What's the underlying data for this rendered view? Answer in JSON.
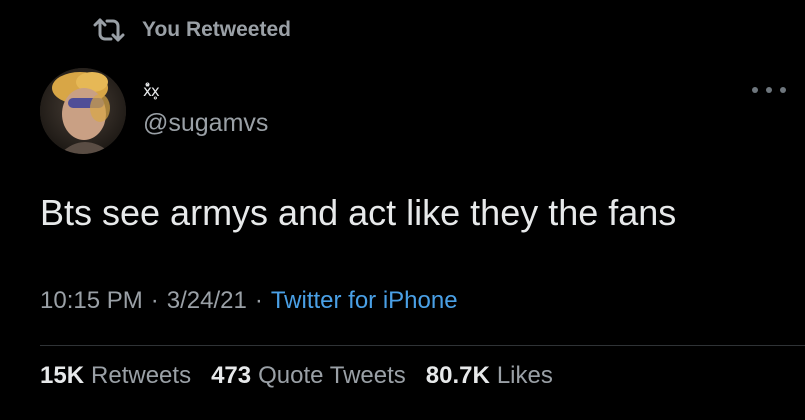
{
  "social_context": {
    "icon": "retweet-icon",
    "text": "You Retweeted"
  },
  "author": {
    "display_name": "x̊̽x̥",
    "handle": "@sugamvs"
  },
  "tweet": {
    "text": "Bts see armys and act like they the fans",
    "time": "10:15 PM",
    "date": "3/24/21",
    "separator": "·",
    "source": "Twitter for iPhone"
  },
  "stats": {
    "retweets_count": "15K",
    "retweets_label": "Retweets",
    "quotes_count": "473",
    "quotes_label": "Quote Tweets",
    "likes_count": "80.7K",
    "likes_label": "Likes"
  },
  "colors": {
    "background": "#000000",
    "primary_text": "#e7e9ea",
    "secondary_text": "#9aa0a6",
    "link": "#4aa0e6",
    "divider": "#2f3336"
  }
}
